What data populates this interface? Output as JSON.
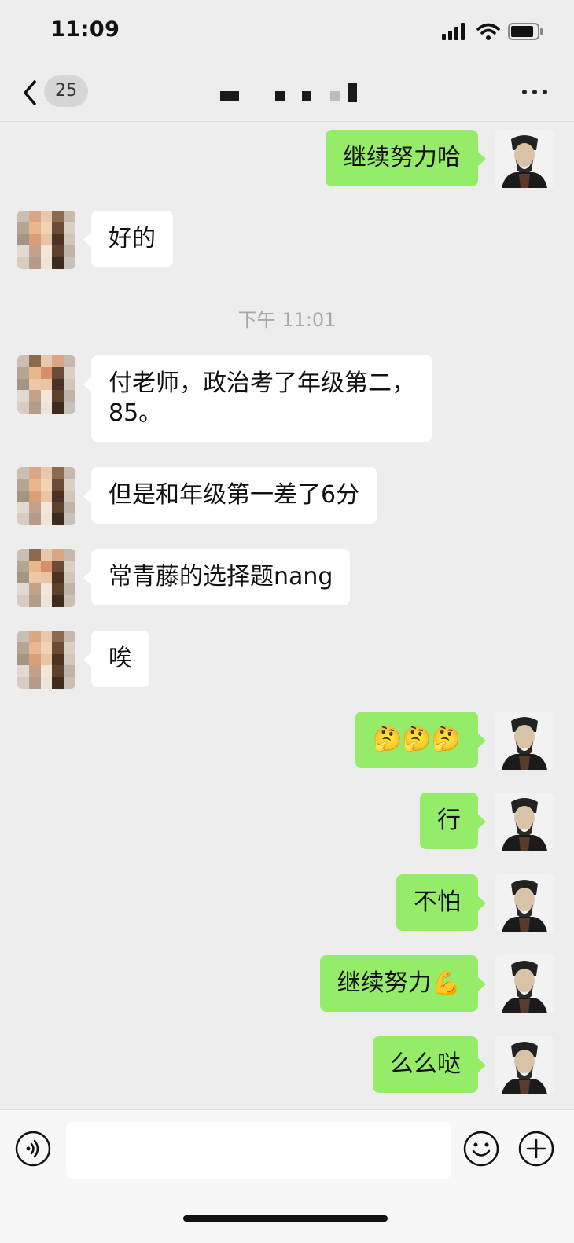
{
  "status_bar": {
    "time": "11:09"
  },
  "nav": {
    "unread_count": "25"
  },
  "messages": [
    {
      "from": "me",
      "text": "继续努力哈"
    },
    {
      "from": "other",
      "text": "好的"
    },
    {
      "timestamp": "下午 11:01"
    },
    {
      "from": "other",
      "text": "付老师，政治考了年级第二，\n85。"
    },
    {
      "from": "other",
      "text": "但是和年级第一差了6分"
    },
    {
      "from": "other",
      "text": "常青藤的选择题nang"
    },
    {
      "from": "other",
      "text": "唉"
    },
    {
      "from": "me",
      "text": "🤔🤔🤔"
    },
    {
      "from": "me",
      "text": "行"
    },
    {
      "from": "me",
      "text": "不怕"
    },
    {
      "from": "me",
      "text": "继续努力💪"
    },
    {
      "from": "me",
      "text": "么么哒"
    }
  ],
  "input": {
    "value": ""
  },
  "colors": {
    "sent_bubble": "#95ec69",
    "received_bubble": "#ffffff",
    "background": "#ededed"
  },
  "icons": [
    "back-icon",
    "more-icon",
    "voice-icon",
    "emoji-icon",
    "plus-icon",
    "signal-icon",
    "wifi-icon",
    "battery-icon"
  ]
}
